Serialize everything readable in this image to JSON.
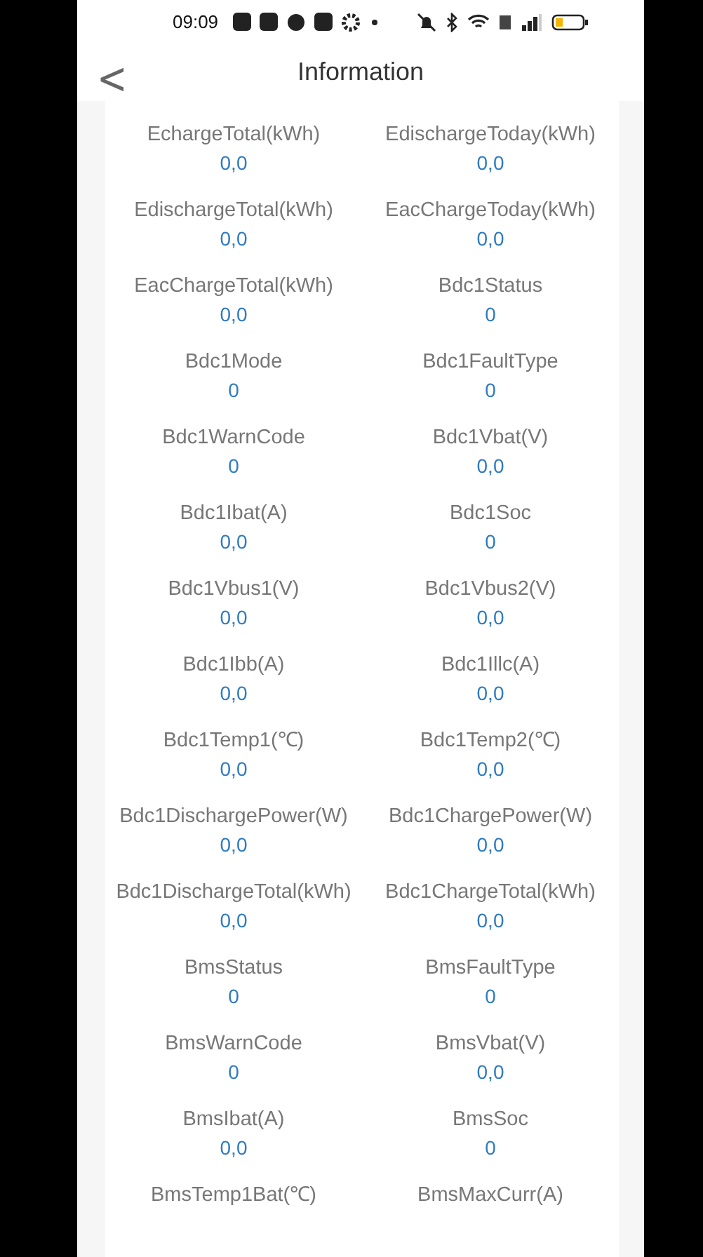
{
  "status_bar": {
    "time": "09:09"
  },
  "header": {
    "back": "<",
    "title": "Information"
  },
  "fields": [
    {
      "label": "EchargeTotal(kWh)",
      "value": "0,0"
    },
    {
      "label": "EdischargeToday(kWh)",
      "value": "0,0"
    },
    {
      "label": "EdischargeTotal(kWh)",
      "value": "0,0"
    },
    {
      "label": "EacChargeToday(kWh)",
      "value": "0,0"
    },
    {
      "label": "EacChargeTotal(kWh)",
      "value": "0,0"
    },
    {
      "label": "Bdc1Status",
      "value": "0"
    },
    {
      "label": "Bdc1Mode",
      "value": "0"
    },
    {
      "label": "Bdc1FaultType",
      "value": "0"
    },
    {
      "label": "Bdc1WarnCode",
      "value": "0"
    },
    {
      "label": "Bdc1Vbat(V)",
      "value": "0,0"
    },
    {
      "label": "Bdc1Ibat(A)",
      "value": "0,0"
    },
    {
      "label": "Bdc1Soc",
      "value": "0"
    },
    {
      "label": "Bdc1Vbus1(V)",
      "value": "0,0"
    },
    {
      "label": "Bdc1Vbus2(V)",
      "value": "0,0"
    },
    {
      "label": "Bdc1Ibb(A)",
      "value": "0,0"
    },
    {
      "label": "Bdc1Illc(A)",
      "value": "0,0"
    },
    {
      "label": "Bdc1Temp1(℃)",
      "value": "0,0"
    },
    {
      "label": "Bdc1Temp2(℃)",
      "value": "0,0"
    },
    {
      "label": "Bdc1DischargePower(W)",
      "value": "0,0"
    },
    {
      "label": "Bdc1ChargePower(W)",
      "value": "0,0"
    },
    {
      "label": "Bdc1DischargeTotal(kWh)",
      "value": "0,0"
    },
    {
      "label": "Bdc1ChargeTotal(kWh)",
      "value": "0,0"
    },
    {
      "label": "BmsStatus",
      "value": "0"
    },
    {
      "label": "BmsFaultType",
      "value": "0"
    },
    {
      "label": "BmsWarnCode",
      "value": "0"
    },
    {
      "label": "BmsVbat(V)",
      "value": "0,0"
    },
    {
      "label": "BmsIbat(A)",
      "value": "0,0"
    },
    {
      "label": "BmsSoc",
      "value": "0"
    },
    {
      "label": "BmsTemp1Bat(℃)"
    },
    {
      "label": "BmsMaxCurr(A)"
    }
  ]
}
